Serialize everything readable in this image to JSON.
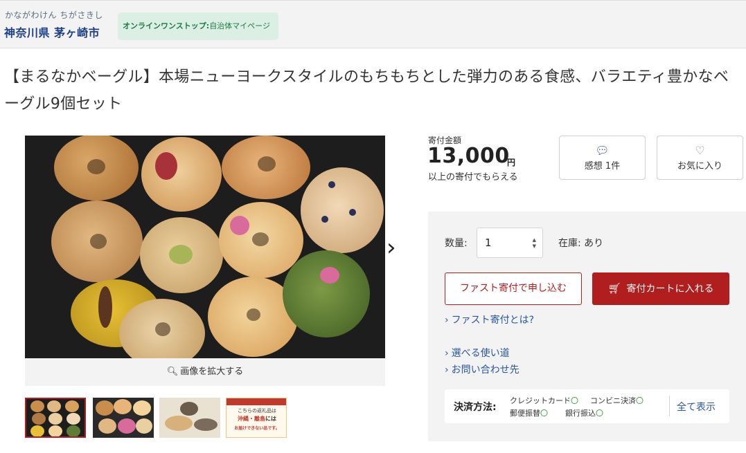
{
  "header": {
    "kana": "かながわけん ちがさきし",
    "city": "神奈川県 茅ヶ崎市",
    "badge_bold": "オンラインワンストップ:",
    "badge_text": "自治体マイページ"
  },
  "product": {
    "title": "【まるなかベーグル】本場ニューヨークスタイルのもちもちとした弾力のある食感、バラエティ豊かなベーグル9個セット",
    "zoom_label": "画像を拡大する",
    "thumb4_line1": "こちらの返礼品は",
    "thumb4_line2": "沖縄・離島",
    "thumb4_line3": "には",
    "thumb4_line4": "お届けできない品です。"
  },
  "donation": {
    "label": "寄付金額",
    "amount": "13,000",
    "unit": "円",
    "note": "以上の寄付でもらえる"
  },
  "actions": {
    "reviews_label": "感想 1件",
    "favorite_label": "お気に入り"
  },
  "order": {
    "qty_label": "数量:",
    "qty_value": "1",
    "stock_text": "在庫: あり",
    "fast_button": "ファスト寄付で申し込む",
    "cart_button": "寄付カートに入れる"
  },
  "links": {
    "fast_about": "ファスト寄付とは?",
    "usage": "選べる使い道",
    "contact": "お問い合わせ先"
  },
  "payment": {
    "label": "決済方法:",
    "methods": [
      "クレジットカード",
      "コンビニ決済",
      "郵便振替",
      "銀行振込"
    ],
    "check": "〇",
    "show_all": "全て表示"
  },
  "colors": {
    "brand_red": "#b01e1e",
    "link_blue": "#2a56a6",
    "city_blue": "#1e3f8a",
    "badge_green": "#1f7a43"
  }
}
